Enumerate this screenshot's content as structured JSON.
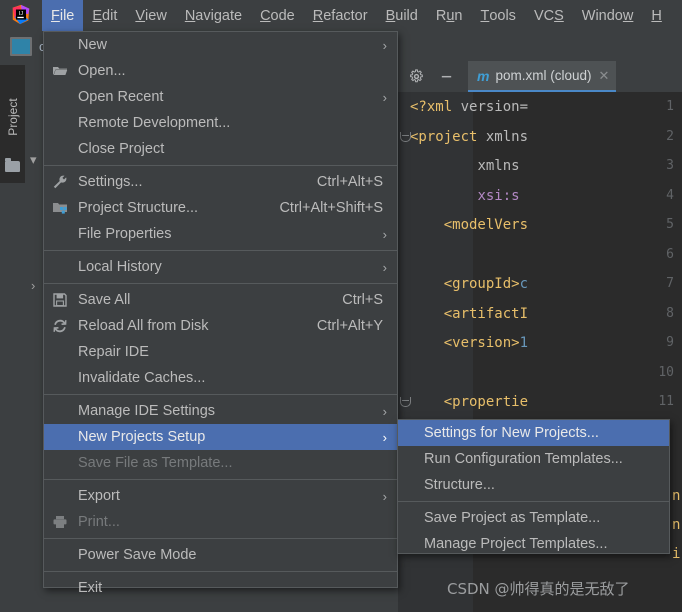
{
  "app": {
    "logo_name": "IntelliJ IDEA",
    "logo_text": "IJ"
  },
  "menubar": {
    "items": [
      {
        "label": "File",
        "mnemonic_index": 0,
        "active": true
      },
      {
        "label": "Edit",
        "mnemonic_index": 0,
        "active": false
      },
      {
        "label": "View",
        "mnemonic_index": 0,
        "active": false
      },
      {
        "label": "Navigate",
        "mnemonic_index": 0,
        "active": false
      },
      {
        "label": "Code",
        "mnemonic_index": 0,
        "active": false
      },
      {
        "label": "Refactor",
        "mnemonic_index": 0,
        "active": false
      },
      {
        "label": "Build",
        "mnemonic_index": 0,
        "active": false
      },
      {
        "label": "Run",
        "mnemonic_index": 1,
        "active": false
      },
      {
        "label": "Tools",
        "mnemonic_index": 0,
        "active": false
      },
      {
        "label": "VCS",
        "mnemonic_index": 2,
        "active": false
      },
      {
        "label": "Window",
        "mnemonic_index": 5,
        "active": false
      },
      {
        "label": "H",
        "mnemonic_index": 0,
        "active": false
      }
    ]
  },
  "breadcrumb": {
    "project_label": "cl"
  },
  "toolwindow": {
    "label": "Project",
    "folder_icon": "folder-icon"
  },
  "editor": {
    "toolbar": {
      "gear_icon": "gear-icon",
      "minimize_icon": "minimize-icon"
    },
    "tab": {
      "type_icon": "maven-m-icon",
      "type_letter": "m",
      "title": "pom.xml (cloud)",
      "close_icon": "close-icon",
      "close_glyph": "✕"
    },
    "lines": [
      {
        "num": "1",
        "text": "<?xml version=",
        "fold": false
      },
      {
        "num": "2",
        "text": "<project xmlns",
        "fold": true
      },
      {
        "num": "3",
        "text": "        xmlns",
        "fold": false
      },
      {
        "num": "4",
        "text": "        xsi:s",
        "fold": false
      },
      {
        "num": "5",
        "text": "    <modelVers",
        "fold": false
      },
      {
        "num": "6",
        "text": "",
        "fold": false
      },
      {
        "num": "7",
        "text": "    <groupId>c",
        "fold": false
      },
      {
        "num": "8",
        "text": "    <artifactI",
        "fold": false
      },
      {
        "num": "9",
        "text": "    <version>1",
        "fold": false
      },
      {
        "num": "10",
        "text": "",
        "fold": false
      },
      {
        "num": "11",
        "text": "    <propertie",
        "fold": true
      }
    ],
    "clipped_tokens": [
      "n",
      "n",
      "i"
    ]
  },
  "file_menu": {
    "items": [
      {
        "label": "New",
        "icon": null,
        "accel": "",
        "submenu": true,
        "disabled": false,
        "selected": false
      },
      {
        "label": "Open...",
        "icon": "folder-open-icon",
        "accel": "",
        "submenu": false,
        "disabled": false,
        "selected": false
      },
      {
        "label": "Open Recent",
        "icon": null,
        "accel": "",
        "submenu": true,
        "disabled": false,
        "selected": false
      },
      {
        "label": "Remote Development...",
        "icon": null,
        "accel": "",
        "submenu": false,
        "disabled": false,
        "selected": false
      },
      {
        "label": "Close Project",
        "icon": null,
        "accel": "",
        "submenu": false,
        "disabled": false,
        "selected": false
      },
      {
        "separator": true
      },
      {
        "label": "Settings...",
        "icon": "wrench-icon",
        "accel": "Ctrl+Alt+S",
        "submenu": false,
        "disabled": false,
        "selected": false
      },
      {
        "label": "Project Structure...",
        "icon": "module-icon",
        "accel": "Ctrl+Alt+Shift+S",
        "submenu": false,
        "disabled": false,
        "selected": false
      },
      {
        "label": "File Properties",
        "icon": null,
        "accel": "",
        "submenu": true,
        "disabled": false,
        "selected": false
      },
      {
        "separator": true
      },
      {
        "label": "Local History",
        "icon": null,
        "accel": "",
        "submenu": true,
        "disabled": false,
        "selected": false
      },
      {
        "separator": true
      },
      {
        "label": "Save All",
        "icon": "save-icon",
        "accel": "Ctrl+S",
        "submenu": false,
        "disabled": false,
        "selected": false
      },
      {
        "label": "Reload All from Disk",
        "icon": "reload-icon",
        "accel": "Ctrl+Alt+Y",
        "submenu": false,
        "disabled": false,
        "selected": false
      },
      {
        "label": "Repair IDE",
        "icon": null,
        "accel": "",
        "submenu": false,
        "disabled": false,
        "selected": false
      },
      {
        "label": "Invalidate Caches...",
        "icon": null,
        "accel": "",
        "submenu": false,
        "disabled": false,
        "selected": false
      },
      {
        "separator": true
      },
      {
        "label": "Manage IDE Settings",
        "icon": null,
        "accel": "",
        "submenu": true,
        "disabled": false,
        "selected": false
      },
      {
        "label": "New Projects Setup",
        "icon": null,
        "accel": "",
        "submenu": true,
        "disabled": false,
        "selected": true
      },
      {
        "label": "Save File as Template...",
        "icon": null,
        "accel": "",
        "submenu": false,
        "disabled": true,
        "selected": false
      },
      {
        "separator": true
      },
      {
        "label": "Export",
        "icon": null,
        "accel": "",
        "submenu": true,
        "disabled": false,
        "selected": false
      },
      {
        "label": "Print...",
        "icon": "printer-icon",
        "accel": "",
        "submenu": false,
        "disabled": true,
        "selected": false
      },
      {
        "separator": true
      },
      {
        "label": "Power Save Mode",
        "icon": null,
        "accel": "",
        "submenu": false,
        "disabled": false,
        "selected": false
      },
      {
        "separator": true
      },
      {
        "label": "Exit",
        "icon": null,
        "accel": "",
        "submenu": false,
        "disabled": false,
        "selected": false
      }
    ]
  },
  "submenu": {
    "title": "New Projects Setup",
    "items": [
      {
        "label": "Settings for New Projects...",
        "selected": true
      },
      {
        "label": "Run Configuration Templates...",
        "selected": false
      },
      {
        "label": "Structure...",
        "selected": false
      },
      {
        "separator": true
      },
      {
        "label": "Save Project as Template...",
        "selected": false
      },
      {
        "label": "Manage Project Templates...",
        "selected": false
      }
    ]
  },
  "watermark": {
    "text": "CSDN @帅得真的是无敌了"
  },
  "colors": {
    "accent_selection": "#4b6eaf",
    "panel_bg": "#3c3f41",
    "editor_bg": "#2b2b2b",
    "gutter_bg": "#313335",
    "text": "#bbbbbb",
    "tab_underline": "#4a88c7"
  }
}
